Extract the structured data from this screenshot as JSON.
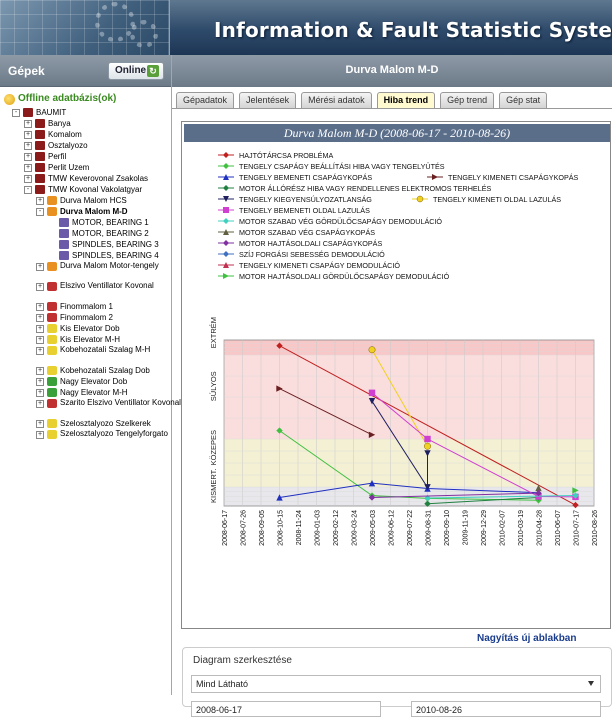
{
  "app": {
    "title": "Information & Fault Statistic System"
  },
  "left": {
    "title": "Gépek",
    "online_label": "Online",
    "root": "Offline adatbázis(ok)",
    "nodes": [
      {
        "label": "BAUMIT",
        "level": 1,
        "icon": "db",
        "exp": "-"
      },
      {
        "label": "Banya",
        "level": 2,
        "icon": "db",
        "exp": "+"
      },
      {
        "label": "Komalom",
        "level": 2,
        "icon": "db",
        "exp": "+"
      },
      {
        "label": "Osztalyozo",
        "level": 2,
        "icon": "db",
        "exp": "+"
      },
      {
        "label": "Perfil",
        "level": 2,
        "icon": "db",
        "exp": "+"
      },
      {
        "label": "Perlit Uzem",
        "level": 2,
        "icon": "db",
        "exp": "+"
      },
      {
        "label": "TMW Keverovonal Zsakolas",
        "level": 2,
        "icon": "db",
        "exp": "+"
      },
      {
        "label": "TMW Kovonal Vakolatgyar",
        "level": 2,
        "icon": "db",
        "exp": "-"
      },
      {
        "label": "Durva Malom HCS",
        "level": 3,
        "icon": "mach",
        "exp": "+"
      },
      {
        "label": "Durva Malom M-D",
        "level": 3,
        "icon": "mach",
        "exp": "-",
        "bold": true
      },
      {
        "label": "MOTOR, BEARING 1",
        "level": 4,
        "icon": "sensor"
      },
      {
        "label": "MOTOR, BEARING 2",
        "level": 4,
        "icon": "sensor"
      },
      {
        "label": "SPINDLES, BEARING 3",
        "level": 4,
        "icon": "sensor"
      },
      {
        "label": "SPINDLES, BEARING 4",
        "level": 4,
        "icon": "sensor"
      },
      {
        "label": "Durva Malom Motor-tengely",
        "level": 3,
        "icon": "mach",
        "exp": "+",
        "two": true
      },
      {
        "label": "Elszivo Ventillator Kovonal",
        "level": 3,
        "icon": "mach red",
        "exp": "+",
        "two": true
      },
      {
        "label": "Finommalom 1",
        "level": 3,
        "icon": "mach red",
        "exp": "+"
      },
      {
        "label": "Finommalom 2",
        "level": 3,
        "icon": "mach red",
        "exp": "+"
      },
      {
        "label": "Kis Elevator Dob",
        "level": 3,
        "icon": "mach yel",
        "exp": "+"
      },
      {
        "label": "Kis Elevator M-H",
        "level": 3,
        "icon": "mach yel",
        "exp": "+"
      },
      {
        "label": "Kobehozatali Szalag M-H",
        "level": 3,
        "icon": "mach yel",
        "exp": "+",
        "two": true
      },
      {
        "label": "Kobehozatali Szalag Dob",
        "level": 3,
        "icon": "mach yel",
        "exp": "+"
      },
      {
        "label": "Nagy Elevator Dob",
        "level": 3,
        "icon": "mach grn",
        "exp": "+"
      },
      {
        "label": "Nagy Elevator M-H",
        "level": 3,
        "icon": "mach grn",
        "exp": "+"
      },
      {
        "label": "Szarito Elszivo Ventillator Kovonal",
        "level": 3,
        "icon": "mach red",
        "exp": "+",
        "two": true
      },
      {
        "label": "Szelosztalyozo Szelkerek",
        "level": 3,
        "icon": "mach yel",
        "exp": "+"
      },
      {
        "label": "Szelosztalyozo Tengelyforgato",
        "level": 3,
        "icon": "mach yel",
        "exp": "+",
        "two": true
      }
    ]
  },
  "main": {
    "title": "Durva Malom M-D",
    "tabs": [
      "Gépadatok",
      "Jelentések",
      "Mérési adatok",
      "Hiba trend",
      "Gép trend",
      "Gép stat"
    ],
    "active_tab": 3,
    "zoom_link": "Nagyítás új ablakban",
    "editor": {
      "title": "Diagram szerkesztése",
      "filter": "Mind Látható",
      "date_from": "2008-06-17",
      "date_to": "2010-08-26"
    }
  },
  "chart_data": {
    "type": "line",
    "title": "Durva Malom M-D (2008-06-17 - 2010-08-26)",
    "y_categories": [
      "KISMERT.",
      "KÖZEPES",
      "SÚLYOS",
      "EXTRÉM"
    ],
    "x_ticks": [
      "2008-06-17",
      "2008-07-26",
      "2008-09-05",
      "2008-10-15",
      "2008-11-24",
      "2009-01-03",
      "2009-02-12",
      "2009-03-24",
      "2009-05-03",
      "2009-06-12",
      "2009-07-22",
      "2009-08-31",
      "2009-09-10",
      "2009-11-19",
      "2009-12-29",
      "2010-02-07",
      "2010-03-19",
      "2010-04-28",
      "2010-06-07",
      "2010-07-17",
      "2010-08-26"
    ],
    "colors": {
      "extreme_band": "#f8c8c8",
      "severe_band": "#fadede",
      "medium_band": "#f4f0d4",
      "minor_band": "#e8e8ec",
      "header": "#5a6e8a"
    },
    "series": [
      {
        "name": "HAJTÓTÁRCSA PROBLÉMA",
        "color": "#c02020",
        "marker": "diamond",
        "points": [
          [
            "2008-10-15",
            3.62
          ],
          [
            "2010-07-17",
            0.05
          ]
        ]
      },
      {
        "name": "TENGELY CSAPÁGY BEÁLLÍTÁSI HIBA VAGY TENGELYÜTÉS",
        "color": "#40c040",
        "marker": "diamond",
        "points": [
          [
            "2008-10-15",
            2.1
          ],
          [
            "2009-05-03",
            0.55
          ],
          [
            "2009-08-31",
            0.4
          ],
          [
            "2010-04-28",
            0.3
          ]
        ]
      },
      {
        "name": "TENGELY BEMENETI CSAPÁGYKOPÁS",
        "color": "#2030c0",
        "marker": "triangle",
        "points": [
          [
            "2008-10-15",
            0.45
          ],
          [
            "2009-05-03",
            1.08
          ],
          [
            "2009-08-31",
            0.92
          ],
          [
            "2010-04-28",
            0.7
          ]
        ]
      },
      {
        "name": "TENGELY KIMENETI CSAPÁGYKOPÁS",
        "color": "#6a2020",
        "marker": "arrow-right",
        "points": [
          [
            "2008-10-15",
            2.6
          ],
          [
            "2009-05-03",
            2.05
          ]
        ]
      },
      {
        "name": "MOTOR ÁLLÓRÉSZ HIBA VAGY RENDELLENES ELEKTROMOS TERHELÉS",
        "color": "#208040",
        "marker": "diamond",
        "points": [
          [
            "2009-08-31",
            0.12
          ],
          [
            "2010-04-28",
            0.45
          ]
        ]
      },
      {
        "name": "TENGELY KIEGYENSÚLYOZATLANSÁG",
        "color": "#202060",
        "marker": "triangle-down",
        "points": [
          [
            "2009-05-03",
            2.45
          ],
          [
            "2009-08-31",
            0.98
          ],
          [
            "2009-08-31",
            1.7
          ]
        ]
      },
      {
        "name": "TENGELY KIMENETI OLDAL LAZULÁS",
        "color": "#f0d020",
        "marker": "circle",
        "points": [
          [
            "2009-05-03",
            3.35
          ],
          [
            "2009-08-31",
            1.85
          ]
        ]
      },
      {
        "name": "TENGELY BEMENETI OLDAL LAZULÁS",
        "color": "#d040d0",
        "marker": "square",
        "points": [
          [
            "2009-05-03",
            2.55
          ],
          [
            "2009-08-31",
            2.0
          ],
          [
            "2010-04-28",
            0.5
          ],
          [
            "2010-07-17",
            0.48
          ]
        ]
      },
      {
        "name": "MOTOR SZABAD VÉG GÖRDÜLŐCSAPÁGY DEMODULÁCIÓ",
        "color": "#40d0c0",
        "marker": "diamond",
        "points": [
          [
            "2009-08-31",
            0.42
          ],
          [
            "2010-07-17",
            0.55
          ]
        ]
      },
      {
        "name": "MOTOR SZABAD VÉG CSAPÁGYKOPÁS",
        "color": "#606040",
        "marker": "triangle",
        "points": [
          [
            "2010-04-28",
            0.95
          ]
        ]
      },
      {
        "name": "MOTOR HAJTÁSOLDALI CSAPÁGYKOPÁS",
        "color": "#8030a0",
        "marker": "diamond",
        "points": [
          [
            "2009-05-03",
            0.45
          ],
          [
            "2010-04-28",
            0.68
          ]
        ]
      },
      {
        "name": "SZÍJ FORGÁSI SEBESSÉG DEMODULÁCIÓ",
        "color": "#4070c0",
        "marker": "diamond",
        "points": []
      },
      {
        "name": "TENGELY KIMENETI CSAPÁGY DEMODULÁCIÓ",
        "color": "#c03050",
        "marker": "triangle",
        "points": []
      },
      {
        "name": "MOTOR HAJTÁSOLDALI GÖRDÜLŐCSAPÁGY DEMODULÁCIÓ",
        "color": "#40c040",
        "marker": "arrow-right",
        "points": [
          [
            "2010-07-17",
            0.82
          ]
        ]
      }
    ]
  }
}
